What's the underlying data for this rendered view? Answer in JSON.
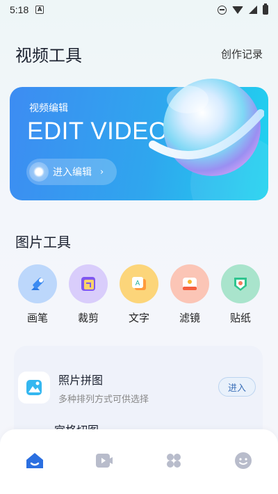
{
  "status": {
    "time": "5:18",
    "app_badge": "A"
  },
  "header": {
    "title": "视频工具",
    "records_link": "创作记录"
  },
  "banner": {
    "subtitle": "视频编辑",
    "headline": "EDIT VIDEO",
    "button_label": "进入编辑",
    "button_arrow": "›"
  },
  "section": {
    "title": "图片工具"
  },
  "tools": [
    {
      "label": "画笔",
      "icon": "brush-icon",
      "color": "#b9d6fb"
    },
    {
      "label": "裁剪",
      "icon": "crop-icon",
      "color": "#d9ccfb"
    },
    {
      "label": "文字",
      "icon": "text-icon",
      "color": "#fcd67c"
    },
    {
      "label": "滤镜",
      "icon": "filter-icon",
      "color": "#fbc6b7"
    },
    {
      "label": "贴纸",
      "icon": "sticker-icon",
      "color": "#a9e5cd"
    }
  ],
  "list": {
    "items": [
      {
        "name": "照片拼图",
        "desc": "多种排列方式可供选择",
        "action": "进入"
      },
      {
        "name": "宫格切图"
      }
    ]
  },
  "tabbar": {
    "icons": [
      "home-icon",
      "video-icon",
      "apps-icon",
      "profile-icon"
    ],
    "active_color": "#2b6fe0",
    "inactive_color": "#b8bccb"
  }
}
